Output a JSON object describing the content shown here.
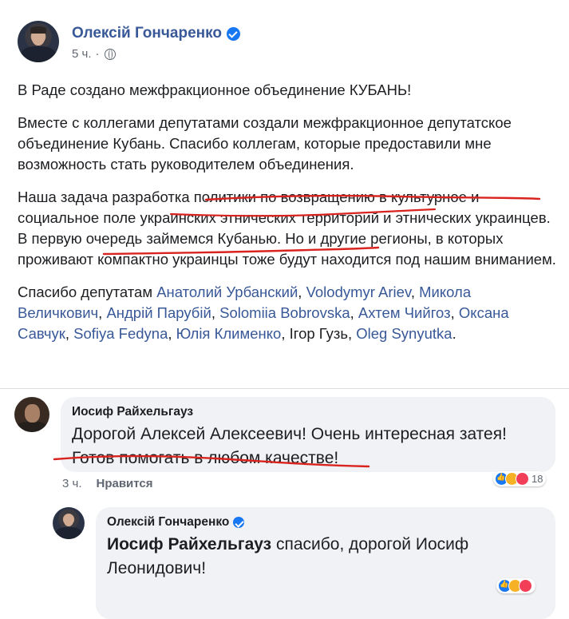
{
  "post": {
    "author": "Олексій Гончаренко",
    "time": "5 ч.",
    "meta_sep": "·",
    "paragraphs": {
      "p1": "В Раде создано межфракционное объединение КУБАНЬ!",
      "p2": "Вместе с коллегами депутатами создали межфракционное депутатское объединение Кубань. Спасибо коллегам, которые предоставили мне возможность стать руководителем объединения.",
      "p3": "Наша задача разработка политики по возвращению в культурное и социальное поле украинских этнических территорий и этнических украинцев. В первую очередь займемся Кубанью. Но и другие регионы, в которых проживают компактно украинцы тоже будут находится под нашим вниманием."
    },
    "thanks": {
      "intro": "Спасибо депутатам ",
      "tags": [
        "Анатолий Урбанский",
        "Volodymyr Ariev",
        "Микола Величкович",
        "Андрій Парубій",
        "Solomiia Bobrovska",
        "Ахтем Чийгоз",
        "Оксана Савчук",
        "Sofiya Fedyna",
        "Юлія Клименко",
        "Ігор Гузь",
        "Oleg Synyutka"
      ],
      "sep": ", ",
      "end": "."
    }
  },
  "comments": [
    {
      "name": "Иосиф Райхельгауз",
      "line1": "Дорогой Алексей Алексеевич! Очень интересная затея!",
      "line2": "Готов помогать в любом качестве!",
      "time": "3 ч.",
      "like_label": "Нравится",
      "reaction_count": "18"
    },
    {
      "name": "Олексій Гончаренко",
      "mention": "Иосиф Райхельгауз",
      "line1_rest": " спасибо, дорогой Иосиф",
      "line2": "Леонидович!"
    }
  ],
  "colors": {
    "link": "#385898",
    "verified": "#1877f2",
    "bubble": "#f0f2f5",
    "annotation": "#d9231f"
  }
}
